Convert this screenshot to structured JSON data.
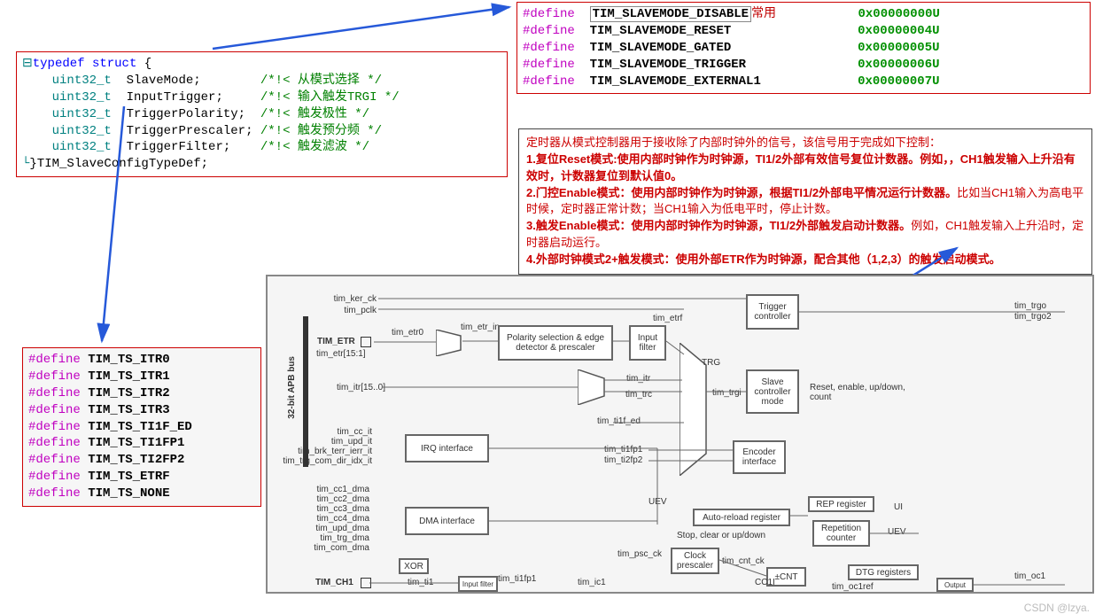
{
  "struct": {
    "open_glyph": "⊟",
    "l1": "typedef struct {",
    "l2_type": "uint32_t",
    "l2_name": "SlaveMode;",
    "l2_c": "/*!< 从模式选择 */",
    "l3_type": "uint32_t",
    "l3_name": "InputTrigger;",
    "l3_c": "/*!< 输入触发TRGI */",
    "l4_type": "uint32_t",
    "l4_name": "TriggerPolarity;",
    "l4_c": "/*!< 触发极性 */",
    "l5_type": "uint32_t",
    "l5_name": "TriggerPrescaler;",
    "l5_c": "/*!< 触发预分频 */",
    "l6_type": "uint32_t",
    "l6_name": "TriggerFilter;",
    "l6_c": "/*!< 触发滤波 */",
    "close_glyph": "└",
    "l7": "}TIM_SlaveConfigTypeDef;"
  },
  "slavemode_defs": {
    "kw": "#define",
    "d1_n": "TIM_SLAVEMODE_DISABLE",
    "d1_note": "常用",
    "d1_v": "0x00000000U",
    "d2_n": "TIM_SLAVEMODE_RESET",
    "d2_v": "0x00000004U",
    "d3_n": "TIM_SLAVEMODE_GATED",
    "d3_v": "0x00000005U",
    "d4_n": "TIM_SLAVEMODE_TRIGGER",
    "d4_v": "0x00000006U",
    "d5_n": "TIM_SLAVEMODE_EXTERNAL1",
    "d5_v": "0x00000007U"
  },
  "ts_defs": {
    "kw": "#define",
    "d1": "TIM_TS_ITR0",
    "d2": "TIM_TS_ITR1",
    "d3": "TIM_TS_ITR2",
    "d4": "TIM_TS_ITR3",
    "d5": "TIM_TS_TI1F_ED",
    "d6": "TIM_TS_TI1FP1",
    "d7": "TIM_TS_TI2FP2",
    "d8": "TIM_TS_ETRF",
    "d9": "TIM_TS_NONE"
  },
  "desc": {
    "intro": "定时器从模式控制器用于接收除了内部时钟外的信号，该信号用于完成如下控制：",
    "r1": "1.复位Reset模式:使用内部时钟作为时钟源，TI1/2外部有效信号复位计数器。例如，，CH1触发输入上升沿有效时，计数器复位到默认值0。",
    "r2": "2.门控Enable模式：使用内部时钟作为时钟源，根据TI1/2外部电平情况运行计数器。",
    "r2b": "比如当CH1输入为高电平时候，定时器正常计数；当CH1输入为低电平时，停止计数。",
    "r3": "3.触发Enable模式：使用内部时钟作为时钟源，TI1/2外部触发启动计数器。",
    "r3b": "例如，CH1触发输入上升沿时，定时器启动运行。",
    "r4": "4.外部时钟模式2+触发模式：使用外部ETR作为时钟源，配合其他（1,2,3）的触发启动模式。"
  },
  "diagram": {
    "apb": "32-bit APB bus",
    "tim_ker_ck": "tim_ker_ck",
    "tim_pclk": "tim_pclk",
    "tim_etr_label": "TIM_ETR",
    "tim_etr0": "tim_etr0",
    "tim_etr15": "tim_etr[15:1]",
    "tim_etr_in": "tim_etr_in",
    "tim_itr": "tim_itr[15..0]",
    "polarity": "Polarity selection & edge detector & prescaler",
    "inputfilter": "Input filter",
    "tim_etrf": "tim_etrf",
    "tim_itr_sig": "tim_itr",
    "tim_trc": "tim_trc",
    "ti1f_ed": "tim_ti1f_ed",
    "ti1fp1": "tim_ti1fp1",
    "ti2fp2": "tim_ti2fp2",
    "trg": "TRG",
    "tim_trgi": "tim_trgi",
    "trigger_ctrl": "Trigger controller",
    "slave_ctrl": "Slave controller mode",
    "encoder": "Encoder interface",
    "reset_enable": "Reset, enable, up/down, count",
    "tim_trgo": "tim_trgo",
    "tim_trgo2": "tim_trgo2",
    "irq": "IRQ interface",
    "dma": "DMA interface",
    "tim_cc_it": "tim_cc_it",
    "tim_upd_it": "tim_upd_it",
    "tim_brk": "tim_brk_terr_ierr_it",
    "tim_trg_com": "tim_trg_com_dir_idx_it",
    "tim_cc1_dma": "tim_cc1_dma",
    "tim_cc2_dma": "tim_cc2_dma",
    "tim_cc3_dma": "tim_cc3_dma",
    "tim_cc4_dma": "tim_cc4_dma",
    "tim_upd_dma": "tim_upd_dma",
    "tim_trg_dma": "tim_trg_dma",
    "tim_com_dma": "tim_com_dma",
    "xor": "XOR",
    "tim_ch1": "TIM_CH1",
    "tim_ti1": "tim_ti1",
    "input_filter2": "Input filter",
    "tim_ti1fp1": "tim_ti1fp1",
    "tim_ic1": "tim_ic1",
    "psc": "Clock prescaler",
    "tim_psc_ck": "tim_psc_ck",
    "tim_cnt_ck": "tim_cnt_ck",
    "cnt": "CNT",
    "auto_reload": "Auto-reload register",
    "stop_clear": "Stop, clear or up/down",
    "uev": "UEV",
    "rep_reg": "REP register",
    "rep_cnt": "Repetition counter",
    "ui": "UI",
    "uev2": "UEV",
    "cc1i": "CC1I",
    "dtg": "DTG registers",
    "output": "Output",
    "tim_oc1": "tim_oc1",
    "tim_oc1ref": "tim_oc1ref"
  },
  "watermark": "CSDN @lzya."
}
